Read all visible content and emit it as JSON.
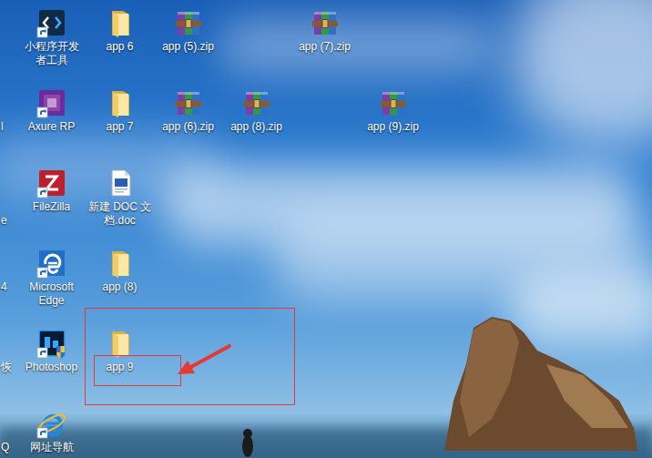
{
  "desktop": {
    "icons": [
      {
        "label": "小程序开发者工具",
        "kind": "shortcut"
      },
      {
        "label": "Axure RP",
        "kind": "shortcut"
      },
      {
        "label": "FileZilla",
        "kind": "shortcut"
      },
      {
        "label": "Microsoft Edge",
        "kind": "shortcut"
      },
      {
        "label": "Photoshop",
        "kind": "shortcut"
      },
      {
        "label": "网址导航",
        "kind": "shortcut"
      },
      {
        "label": "app 6",
        "kind": "folder"
      },
      {
        "label": "app 7",
        "kind": "folder"
      },
      {
        "label": "新建 DOC 文档.doc",
        "kind": "document"
      },
      {
        "label": "app (8)",
        "kind": "folder"
      },
      {
        "label": "app 9",
        "kind": "folder"
      },
      {
        "label": "app (5).zip",
        "kind": "archive"
      },
      {
        "label": "app (6).zip",
        "kind": "archive"
      },
      {
        "label": "app (8).zip",
        "kind": "archive"
      },
      {
        "label": "app (7).zip",
        "kind": "archive"
      },
      {
        "label": "app (9).zip",
        "kind": "archive"
      }
    ],
    "cut_labels": [
      "l",
      "e",
      "4",
      "恢",
      "Q"
    ]
  }
}
